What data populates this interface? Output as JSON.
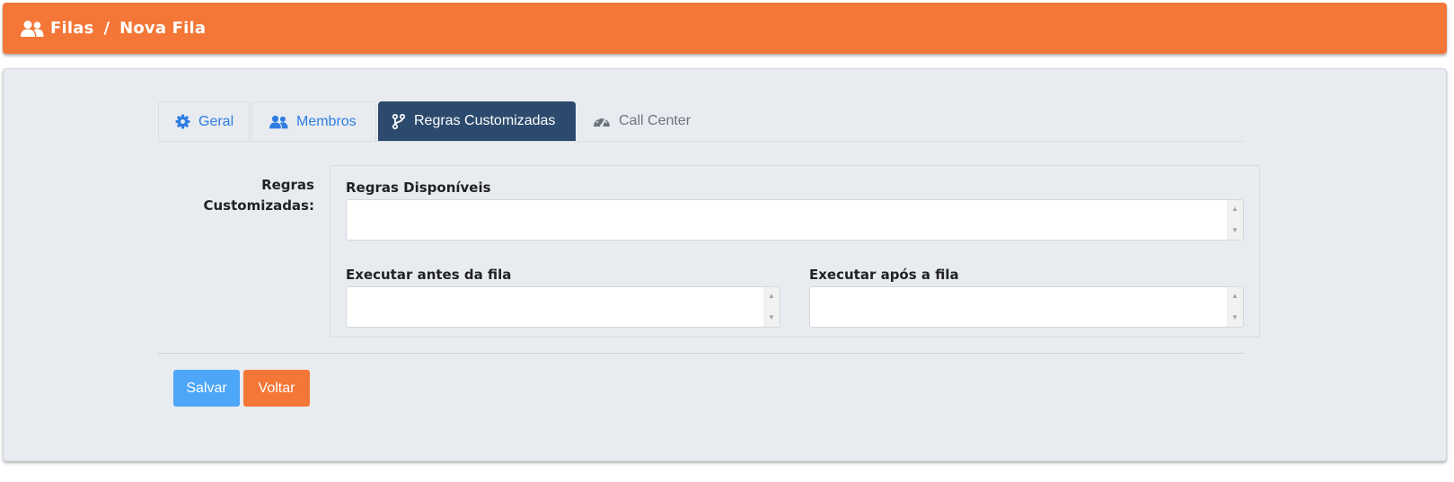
{
  "header": {
    "icon": "users-icon",
    "breadcrumb": [
      "Filas",
      "Nova Fila"
    ],
    "separator": "/",
    "background": "#f47737"
  },
  "tabs": [
    {
      "label": "Geral",
      "icon": "gear-icon",
      "state": "inactive"
    },
    {
      "label": "Membros",
      "icon": "users-icon",
      "state": "inactive"
    },
    {
      "label": "Regras Customizadas",
      "icon": "code-branch-icon",
      "state": "active"
    },
    {
      "label": "Call Center",
      "icon": "gauge-icon",
      "state": "disabled"
    }
  ],
  "form": {
    "section_label_line1": "Regras",
    "section_label_line2": "Customizadas:",
    "available_label": "Regras Disponíveis",
    "before_label": "Executar antes da fila",
    "after_label": "Executar após a fila"
  },
  "buttons": {
    "save": "Salvar",
    "back": "Voltar"
  },
  "colors": {
    "accent": "#f47737",
    "active_tab": "#2c4a6e",
    "link": "#2f7de1",
    "save_button": "#4ea6f8"
  }
}
